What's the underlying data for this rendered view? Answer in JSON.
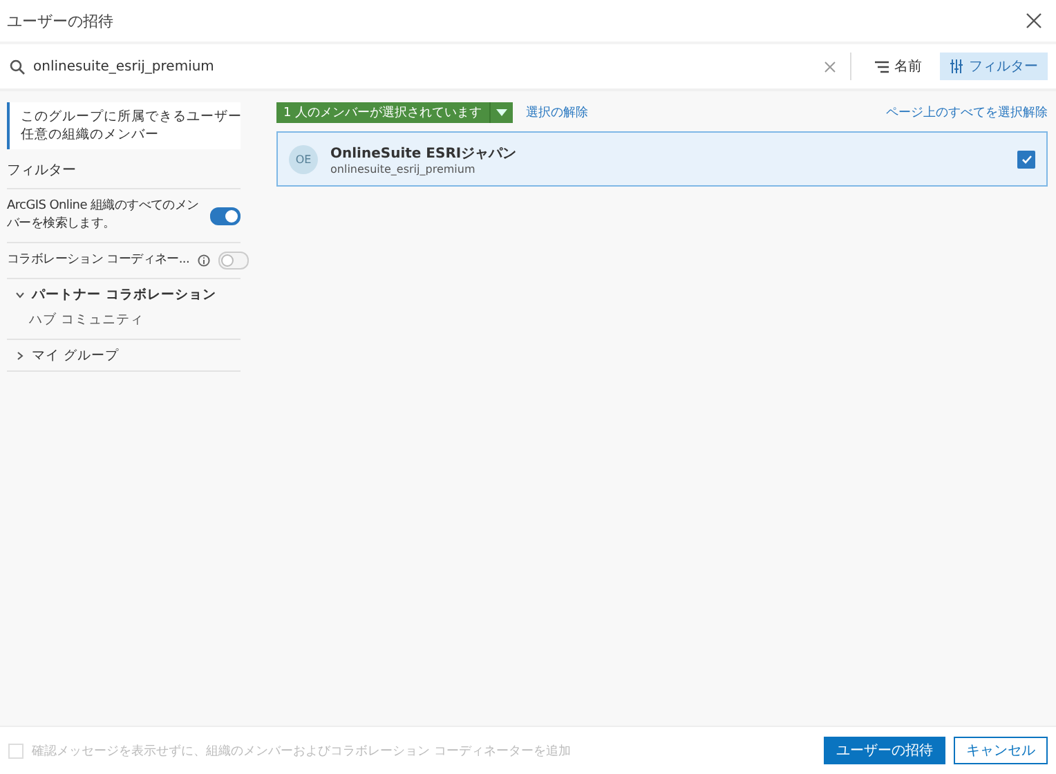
{
  "dialog": {
    "title": "ユーザーの招待"
  },
  "search": {
    "value": "onlinesuite_esrij_premium"
  },
  "toolbar": [
    {
      "label": "名前",
      "kind": "sort",
      "selected": false
    },
    {
      "label": "フィルター",
      "kind": "filter",
      "selected": true
    }
  ],
  "sidebar": {
    "scope": [
      "このグループに所属できるユーザー",
      "任意の組織のメンバー"
    ],
    "filter_heading": "フィルター",
    "toggles": [
      {
        "label": "ArcGIS Online 組織のすべてのメンバーを検索します。",
        "on": true,
        "info": false
      },
      {
        "label": "コラボレーション コーディネー...",
        "on": false,
        "info": true
      }
    ],
    "groups": [
      {
        "label": "パートナー コラボレーション",
        "expanded": true,
        "children": [
          {
            "label": "ハブ コミュニティ"
          }
        ]
      },
      {
        "label": "マイ グループ",
        "expanded": false
      }
    ]
  },
  "selection": {
    "count_label": "1 人のメンバーが選択されています",
    "clear_link": "選択の解除",
    "clear_page_link": "ページ上のすべてを選択解除"
  },
  "users": [
    {
      "initials": "OE",
      "name": "OnlineSuite ESRIジャパン",
      "username": "onlinesuite_esrij_premium",
      "selected": true
    }
  ],
  "footer": {
    "checkbox": {
      "label": "確認メッセージを表示せずに、組織のメンバーおよびコラボレーション コーディネーターを追加",
      "checked": false,
      "disabled": true
    },
    "buttons": [
      {
        "label": "ユーザーの招待",
        "kind": "primary"
      },
      {
        "label": "キャンセル",
        "kind": "secondary"
      }
    ]
  }
}
